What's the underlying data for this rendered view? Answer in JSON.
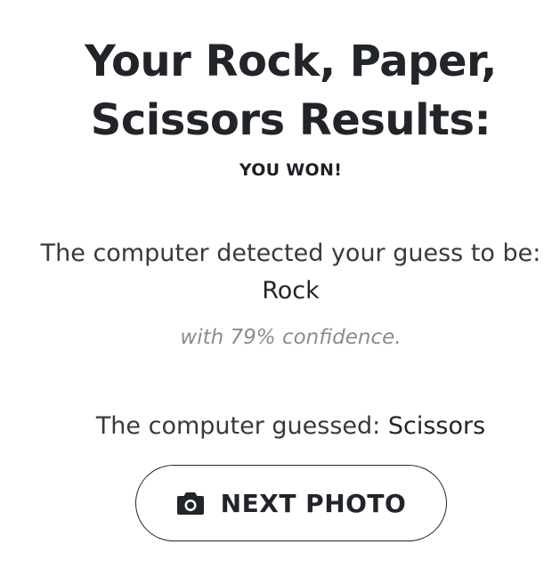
{
  "results": {
    "title_line1": "Your Rock, Paper,",
    "title_line2": "Scissors Results:",
    "outcome": "YOU WON!"
  },
  "detection": {
    "label": "The computer detected your guess to be:",
    "value": "Rock",
    "confidence_text": "with 79% confidence."
  },
  "computer": {
    "label": "The computer guessed:",
    "value": "Scissors"
  },
  "next_button": {
    "label": "NEXT PHOTO",
    "icon": "camera-icon"
  }
}
